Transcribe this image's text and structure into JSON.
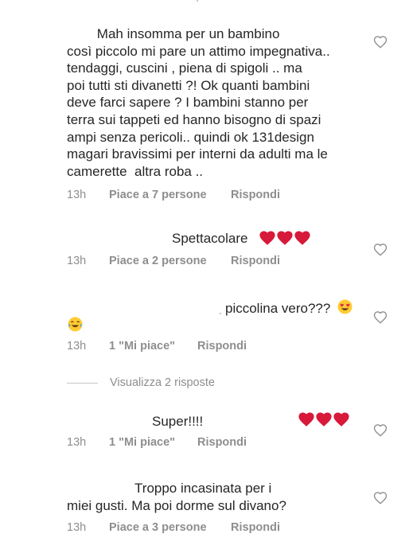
{
  "comments": [
    {
      "lines": [
        "        Mah insomma per un bambino",
        "così piccolo mi pare un attimo impegnativa..",
        "tendaggi, cuscini , piena di spigoli .. ma",
        "poi tutti sti divanetti ?! Ok quanti bambini",
        "deve farci sapere ? I bambini stanno per",
        "terra sui tappeti ed hanno bisogno di spazi",
        "ampi senza pericoli.. quindi ok 131design",
        "magari bravissimi per interni da adulti ma le",
        "camerette  altra roba .."
      ],
      "time": "13h",
      "likes": "Piace a 7 persone",
      "reply": "Rispondi"
    },
    {
      "text": "Spettacolare",
      "emoji": "red-heart x3",
      "time": "13h",
      "likes": "Piace a 2 persone",
      "reply": "Rispondi"
    },
    {
      "text": "piccolina vero???",
      "emoji": "smiling-face-with-heart-eyes, face-with-tears-of-joy",
      "time": "13h",
      "likes": "1 \"Mi piace\"",
      "reply": "Rispondi",
      "view_replies": "Visualizza 2 risposte"
    },
    {
      "text": "Super!!!!",
      "emoji": "red-heart x3",
      "time": "13h",
      "likes": "1 \"Mi piace\"",
      "reply": "Rispondi"
    },
    {
      "lines": [
        "                  Troppo incasinata per i",
        "miei gusti. Ma poi dorme sul divano?"
      ],
      "time": "13h",
      "likes": "Piace a 3 persone",
      "reply": "Rispondi"
    }
  ],
  "icons": {
    "like": "heart-outline-icon",
    "heart": "red-heart-emoji"
  },
  "colors": {
    "text": "#262626",
    "meta": "#8e8e8e",
    "heart_red": "#d7193a",
    "heart_outline": "#8e8e8e"
  }
}
